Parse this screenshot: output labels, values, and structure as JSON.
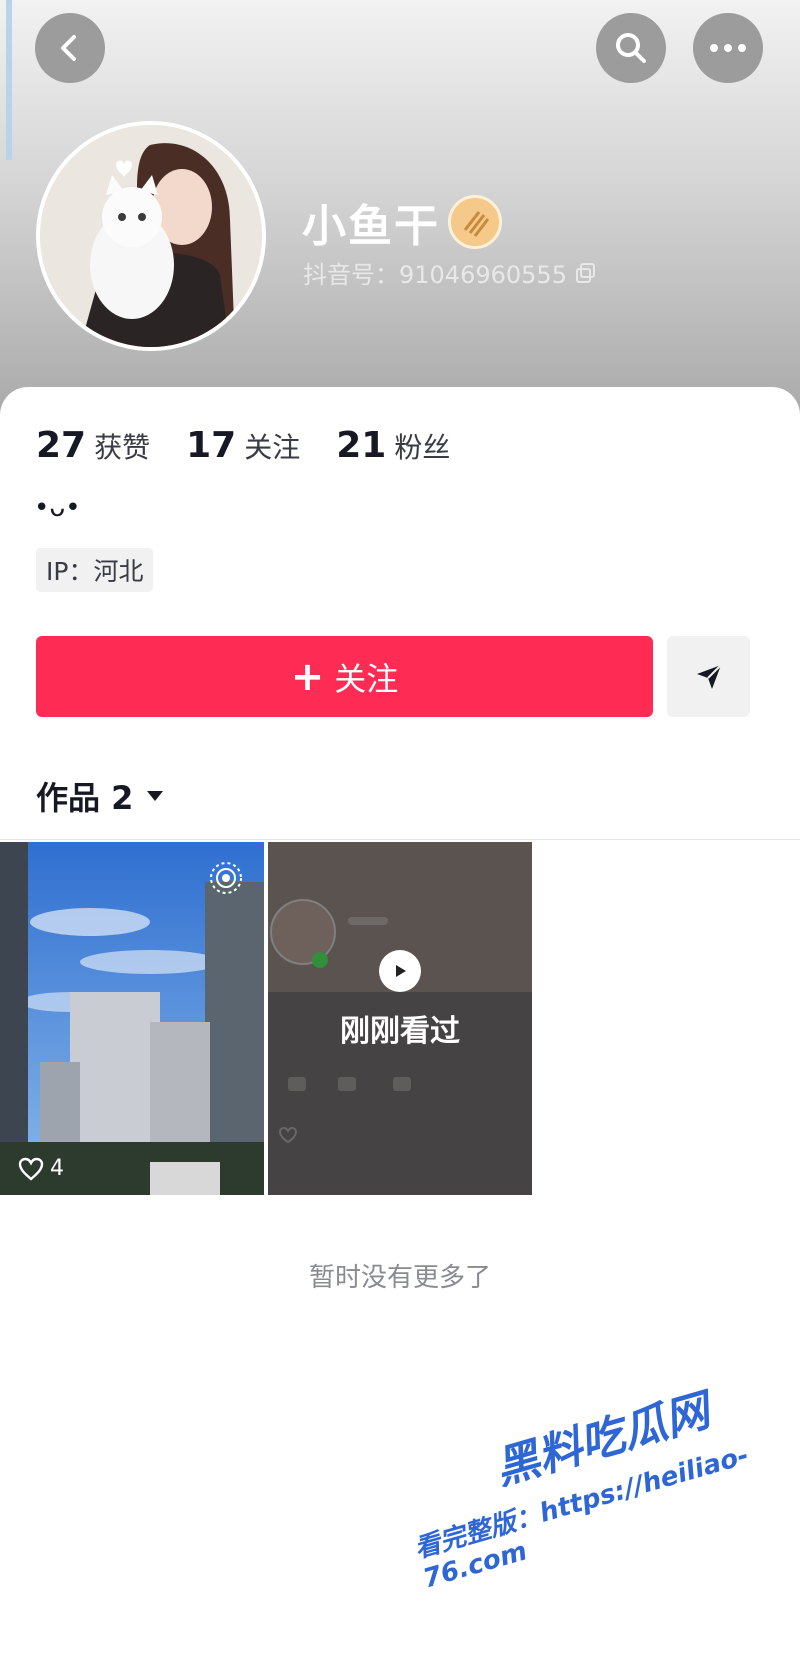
{
  "colors": {
    "accent": "#fe2c55",
    "watermark": "#2e66d6"
  },
  "header": {
    "back_icon": "chevron-left-icon",
    "search_icon": "search-icon",
    "more_icon": "more-icon"
  },
  "profile": {
    "name": "小鱼干",
    "douyin_id": "抖音号：91046960555",
    "stats": [
      {
        "value": "27",
        "label": "获赞"
      },
      {
        "value": "17",
        "label": "关注"
      },
      {
        "value": "21",
        "label": "粉丝"
      }
    ],
    "bio": "•ᴗ•",
    "ip": "IP：河北"
  },
  "actions": {
    "follow_label": "关注",
    "share_icon": "send-icon"
  },
  "works": {
    "tab_label": "作品 2",
    "items": [
      {
        "likes": "4"
      },
      {
        "overlay_label": "刚刚看过"
      }
    ],
    "end_text": "暂时没有更多了"
  },
  "watermark": {
    "brand": "黑料吃瓜网",
    "url": "看完整版：https://heiliao-76.com"
  }
}
